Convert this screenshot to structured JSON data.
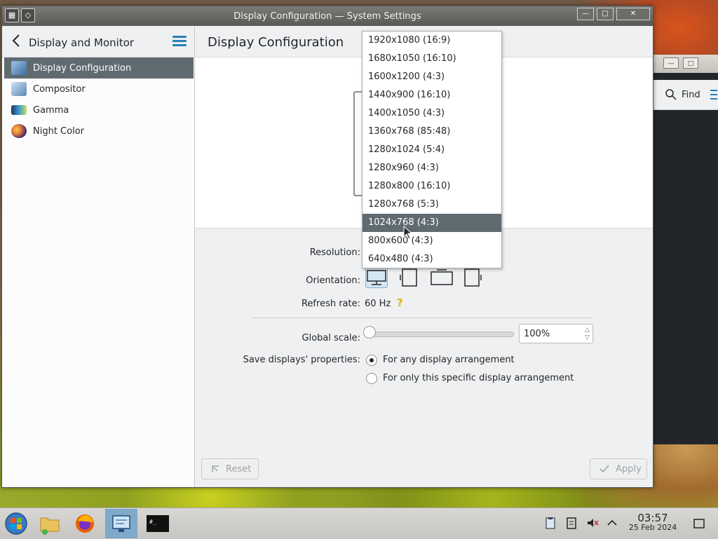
{
  "window": {
    "title": "Display Configuration — System Settings"
  },
  "background_window": {
    "find_label": "Find"
  },
  "sidebar": {
    "header": "Display and Monitor",
    "items": [
      {
        "label": "Display Configuration",
        "icon": "display-config-icon",
        "active": true
      },
      {
        "label": "Compositor",
        "icon": "compositor-icon",
        "active": false
      },
      {
        "label": "Gamma",
        "icon": "gamma-icon",
        "active": false
      },
      {
        "label": "Night Color",
        "icon": "night-color-icon",
        "active": false
      }
    ]
  },
  "main": {
    "title": "Display Configuration",
    "resolution_label": "Resolution:",
    "orientation_label": "Orientation:",
    "refresh_label": "Refresh rate:",
    "refresh_value": "60 Hz",
    "global_scale_label": "Global scale:",
    "global_scale_value": "100%",
    "global_scale_fraction": 0.0,
    "save_label": "Save displays' properties:",
    "save_options": [
      {
        "label": "For any display arrangement",
        "checked": true
      },
      {
        "label": "For only this specific display arrangement",
        "checked": false
      }
    ],
    "reset_label": "Reset",
    "apply_label": "Apply"
  },
  "resolution_dropdown": {
    "selected": "1024x768 (4:3)",
    "options": [
      "1920x1080 (16:9)",
      "1680x1050 (16:10)",
      "1600x1200 (4:3)",
      "1440x900 (16:10)",
      "1400x1050 (4:3)",
      "1360x768 (85:48)",
      "1280x1024 (5:4)",
      "1280x960 (4:3)",
      "1280x800 (16:10)",
      "1280x768 (5:3)",
      "1024x768 (4:3)",
      "800x600 (4:3)",
      "640x480 (4:3)"
    ]
  },
  "taskbar": {
    "time": "03:57",
    "date": "25 Feb 2024"
  },
  "colors": {
    "accent": "#2980b9",
    "selection": "#5f6b70",
    "window_bg": "#eff0f1"
  }
}
